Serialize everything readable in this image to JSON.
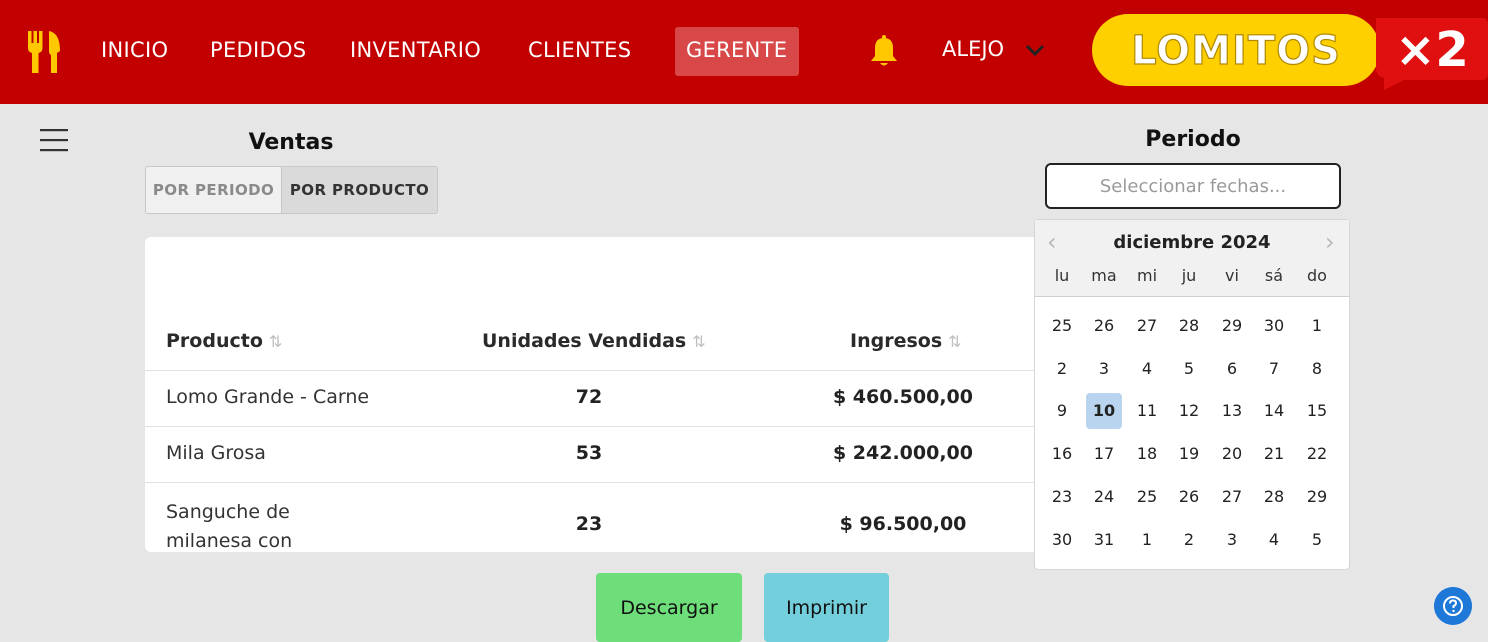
{
  "nav": {
    "items": [
      "INICIO",
      "PEDIDOS",
      "INVENTARIO",
      "CLIENTES",
      "GERENTE"
    ],
    "active": "GERENTE",
    "user": "ALEJO",
    "logo_text": "LOMITOS",
    "logo_badge": "x2"
  },
  "colors": {
    "topbar": "#c30000",
    "logo_yellow": "#ffd000",
    "download_button": "#6ede7b",
    "print_button": "#74cfdd",
    "selected_day": "#b9d4ee"
  },
  "icons": {
    "brand": "fork-knife-icon",
    "notifications": "bell-icon",
    "menu": "hamburger-menu-icon",
    "help": "help-icon"
  },
  "ventas": {
    "title": "Ventas",
    "tabs": [
      "POR PERIODO",
      "POR PRODUCTO"
    ],
    "active_tab": "POR PRODUCTO"
  },
  "table": {
    "headers": [
      "Producto",
      "Unidades Vendidas",
      "Ingresos"
    ],
    "sort_icon": "⇅",
    "rows": [
      {
        "product": "Lomo Grande - Carne",
        "units": "72",
        "income": "$ 460.500,00"
      },
      {
        "product": "Mila Grosa",
        "units": "53",
        "income": "$ 242.000,00"
      },
      {
        "product": "Sanguche de milanesa con papas",
        "units": "23",
        "income": "$ 96.500,00"
      }
    ]
  },
  "periodo": {
    "title": "Periodo",
    "placeholder": "Seleccionar fechas..."
  },
  "calendar": {
    "month": "diciembre 2024",
    "prev": "‹",
    "next": "›",
    "weekdays": [
      "lu",
      "ma",
      "mi",
      "ju",
      "vi",
      "sá",
      "do"
    ],
    "weeks": [
      [
        "25",
        "26",
        "27",
        "28",
        "29",
        "30",
        "1"
      ],
      [
        "2",
        "3",
        "4",
        "5",
        "6",
        "7",
        "8"
      ],
      [
        "9",
        "10",
        "11",
        "12",
        "13",
        "14",
        "15"
      ],
      [
        "16",
        "17",
        "18",
        "19",
        "20",
        "21",
        "22"
      ],
      [
        "23",
        "24",
        "25",
        "26",
        "27",
        "28",
        "29"
      ],
      [
        "30",
        "31",
        "1",
        "2",
        "3",
        "4",
        "5"
      ]
    ],
    "selected": "10"
  },
  "actions": {
    "download": "Descargar",
    "print": "Imprimir"
  }
}
